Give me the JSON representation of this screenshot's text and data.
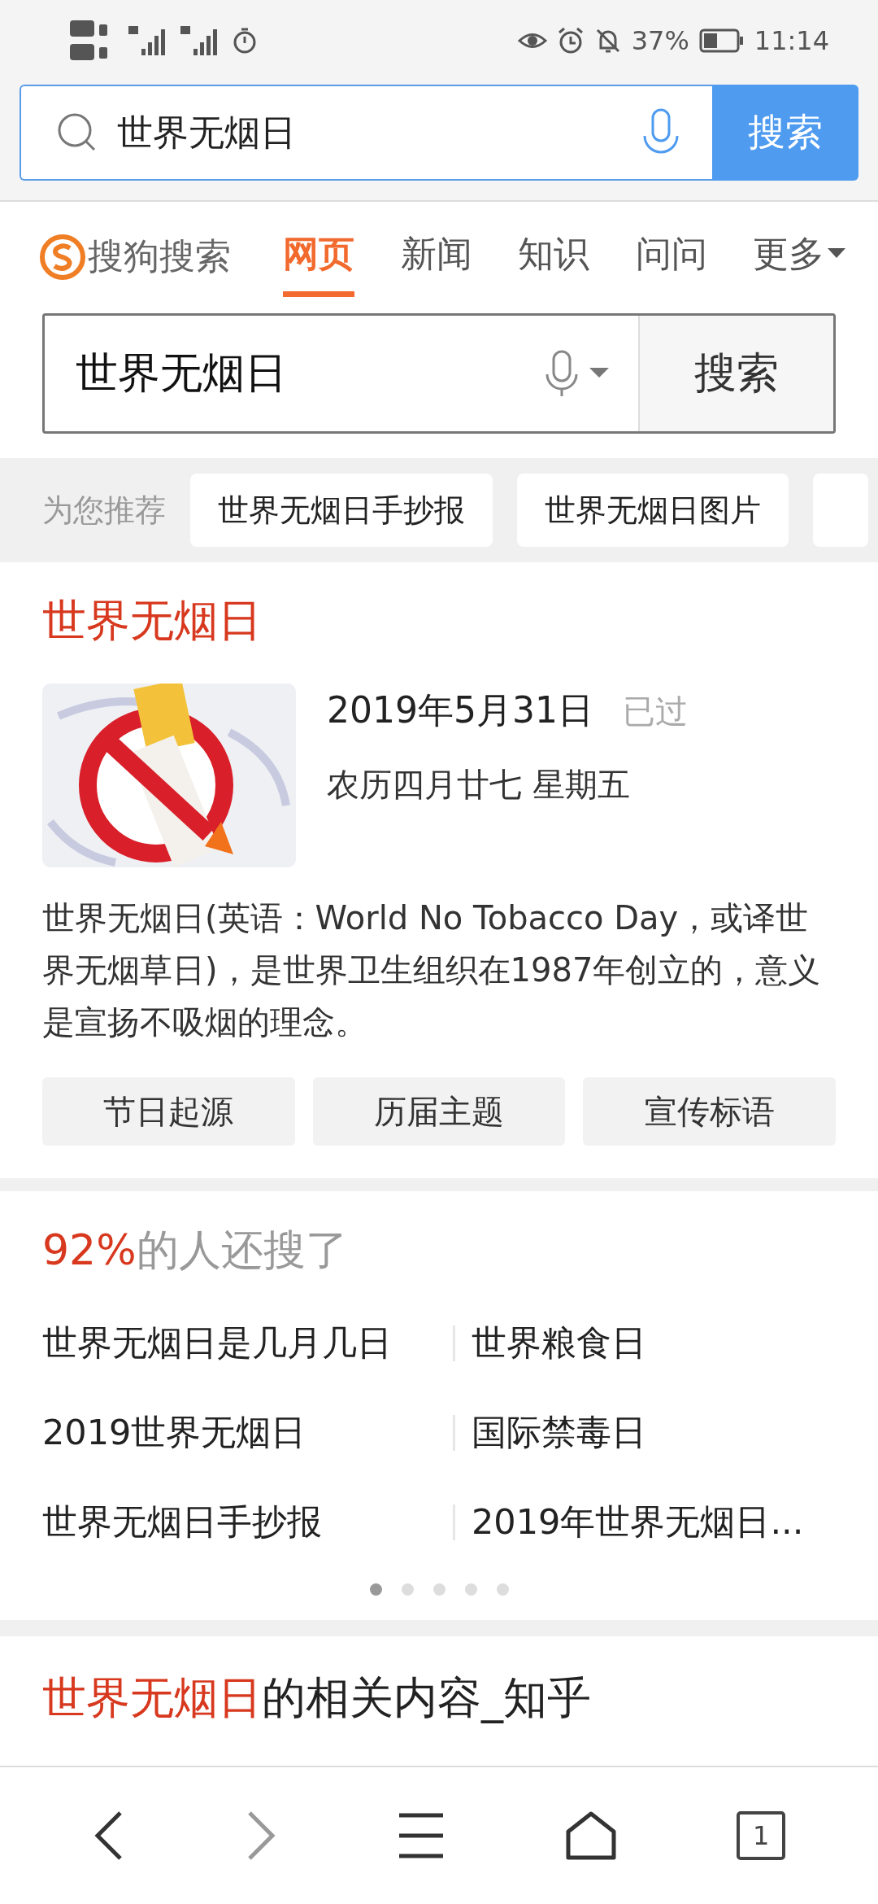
{
  "status_bar": {
    "battery": "37%",
    "time": "11:14"
  },
  "browser_search": {
    "value": "世界无烟日",
    "button": "搜索"
  },
  "sogou_header": {
    "logo": "搜狗搜索",
    "tabs": [
      {
        "label": "网页",
        "selected": true,
        "kind": "tab"
      },
      {
        "label": "新闻",
        "selected": false,
        "kind": "tab"
      },
      {
        "label": "知识",
        "selected": false,
        "kind": "tab"
      },
      {
        "label": "问问",
        "selected": false,
        "kind": "tab"
      },
      {
        "label": "更多",
        "selected": false,
        "kind": "dropdown"
      }
    ]
  },
  "search": {
    "value": "世界无烟日",
    "button": "搜索"
  },
  "recommend": {
    "label": "为您推荐",
    "chips": [
      "世界无烟日手抄报",
      "世界无烟日图片"
    ]
  },
  "event_card": {
    "title": "世界无烟日",
    "date": "2019年5月31日",
    "status": "已过",
    "lunar": "农历四月廿七 星期五",
    "description": "世界无烟日(英语：World No Tobacco Day，或译世界无烟草日)，是世界卫生组织在1987年创立的，意义是宣扬不吸烟的理念。",
    "buttons": [
      "节日起源",
      "历届主题",
      "宣传标语"
    ]
  },
  "related": {
    "percent": "92%",
    "title_rest": "的人还搜了",
    "items": [
      "世界无烟日是几月几日",
      "世界粮食日",
      "2019世界无烟日",
      "国际禁毒日",
      "世界无烟日手抄报",
      "2019年世界无烟日..."
    ],
    "pages": [
      {
        "selected": true
      },
      {
        "selected": false
      },
      {
        "selected": false
      },
      {
        "selected": false
      },
      {
        "selected": false
      }
    ]
  },
  "next_card": {
    "highlight": "世界无烟日",
    "rest": "的相关内容_知乎"
  },
  "bottom_nav": {
    "tab_count": "1"
  }
}
